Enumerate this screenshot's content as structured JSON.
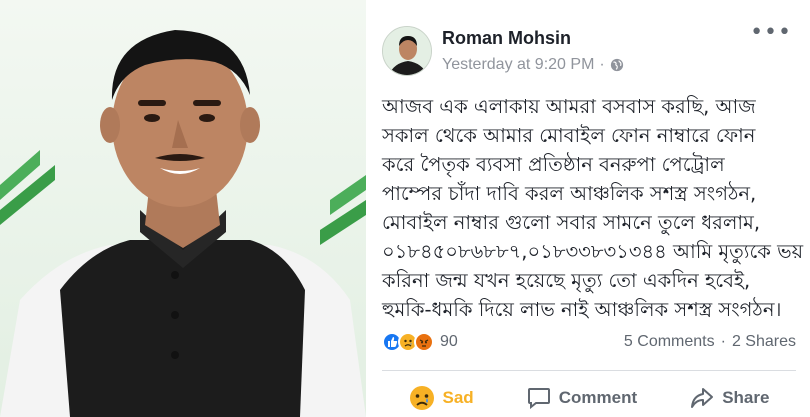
{
  "post": {
    "author": "Roman Mohsin",
    "timestamp": "Yesterday at 9:20 PM",
    "meta_separator": "·",
    "more_label": "•••",
    "text_lines": [
      "আজব এক এলাকায় আমরা বসবাস করছি, আজ",
      "সকাল থেকে আমার মোবাইল ফোন নাম্বারে ফোন",
      "করে পৈতৃক ব্যবসা প্রতিষ্ঠান বনরুপা  পেট্রোল",
      "পাম্পের চাঁদা দাবি করল আঞ্চলিক সশস্ত্র সংগঠন,",
      "মোবাইল নাম্বার গুলো  সবার সামনে তুলে ধরলাম,",
      "০১৮৪৫০৮৬৮৮৭,০১৮৩৩৮৩১৩৪৪ আমি মৃত্যুকে ভয়",
      "করিনা জন্ম যখন হয়েছে মৃত্যু তো একদিন হবেই,",
      "হুমকি-ধমকি দিয়ে লাভ নাই আঞ্চলিক সশস্ত্র সংগঠন।"
    ],
    "reactions": {
      "icons": [
        "like-icon",
        "sad-icon",
        "angry-icon"
      ],
      "count": "90",
      "comments": "5 Comments",
      "separator": "·",
      "shares": "2 Shares"
    },
    "actions": {
      "reaction_label": "Sad",
      "comment_label": "Comment",
      "share_label": "Share"
    }
  },
  "colors": {
    "like": "#1877f2",
    "sad": "#f7b125",
    "angry": "#e9710f",
    "text": "#1d2129",
    "muted": "#90949c",
    "photo_bg": "#e6f2e7"
  }
}
